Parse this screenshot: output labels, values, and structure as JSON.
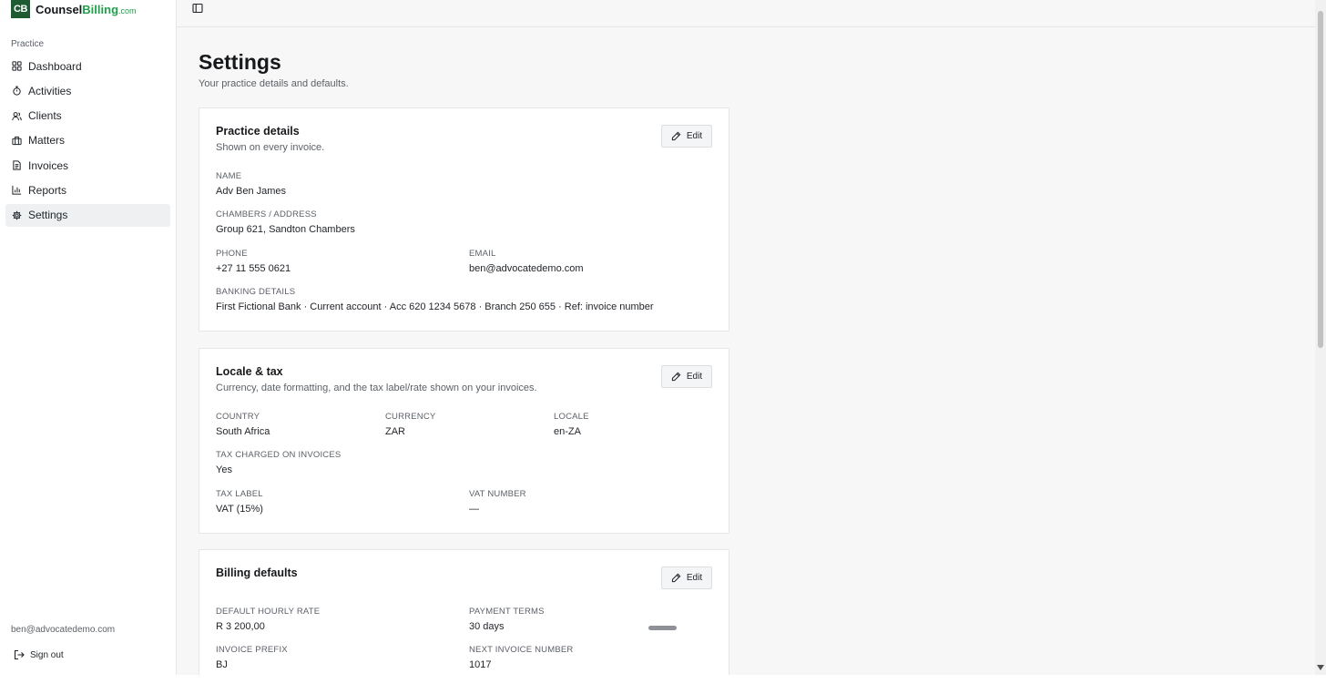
{
  "brand": {
    "logo_text": "CB",
    "name_prefix": "Counsel",
    "name_accent": "Billing",
    "tld": ".com"
  },
  "sidebar": {
    "section_label": "Practice",
    "items": [
      {
        "label": "Dashboard",
        "icon": "dashboard-grid-icon"
      },
      {
        "label": "Activities",
        "icon": "timer-icon"
      },
      {
        "label": "Clients",
        "icon": "users-icon"
      },
      {
        "label": "Matters",
        "icon": "briefcase-icon"
      },
      {
        "label": "Invoices",
        "icon": "document-icon"
      },
      {
        "label": "Reports",
        "icon": "bar-chart-icon"
      },
      {
        "label": "Settings",
        "icon": "gear-icon",
        "active": true
      }
    ],
    "user_email": "ben@advocatedemo.com",
    "sign_out_label": "Sign out"
  },
  "page": {
    "title": "Settings",
    "subtitle": "Your practice details and defaults."
  },
  "practice": {
    "title": "Practice details",
    "description": "Shown on every invoice.",
    "edit_label": "Edit",
    "name_label": "Name",
    "name_value": "Adv Ben James",
    "address_label": "Chambers / Address",
    "address_value": "Group 621, Sandton Chambers",
    "phone_label": "Phone",
    "phone_value": "+27 11 555 0621",
    "email_label": "Email",
    "email_value": "ben@advocatedemo.com",
    "banking_label": "Banking details",
    "banking_value": "First Fictional Bank · Current account · Acc 620 1234 5678 · Branch 250 655 · Ref: invoice number"
  },
  "locale": {
    "title": "Locale & tax",
    "description": "Currency, date formatting, and the tax label/rate shown on your invoices.",
    "edit_label": "Edit",
    "country_label": "Country",
    "country_value": "South Africa",
    "currency_label": "Currency",
    "currency_value": "ZAR",
    "locale_label": "Locale",
    "locale_value": "en-ZA",
    "tax_charged_label": "Tax charged on invoices",
    "tax_charged_value": "Yes",
    "tax_label_label": "Tax label",
    "tax_label_value": "VAT (15%)",
    "vat_number_label": "VAT number",
    "vat_number_value": "—"
  },
  "billing": {
    "title": "Billing defaults",
    "edit_label": "Edit",
    "rate_label": "Default hourly rate",
    "rate_value": "R 3 200,00",
    "terms_label": "Payment terms",
    "terms_value": "30 days",
    "prefix_label": "Invoice prefix",
    "prefix_value": "BJ",
    "next_label": "Next invoice number",
    "next_value": "1017"
  },
  "colors": {
    "brand_green": "#1e5a32",
    "accent_green": "#21a04a",
    "active_bg": "#eef0f2"
  }
}
